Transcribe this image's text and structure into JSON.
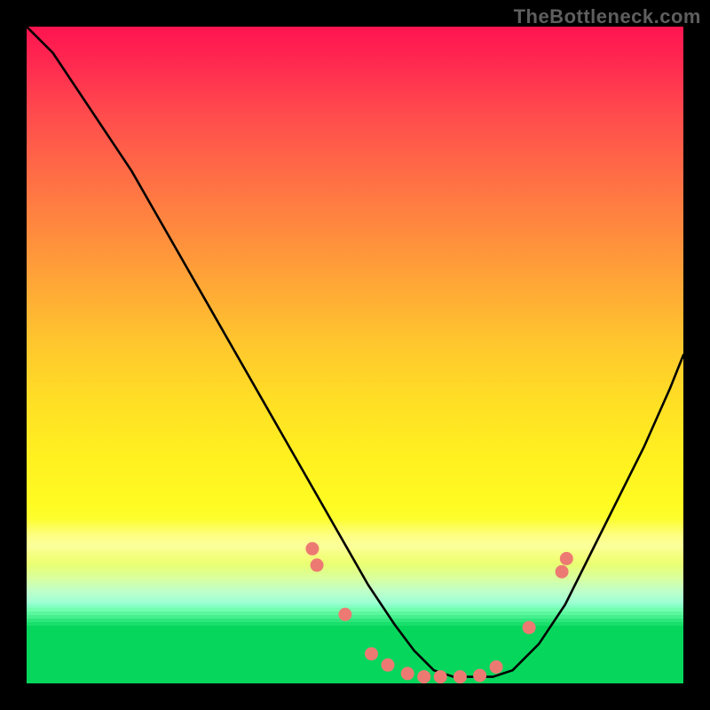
{
  "watermark": "TheBottleneck.com",
  "chart_data": {
    "type": "line",
    "title": "",
    "xlabel": "",
    "ylabel": "",
    "xlim": [
      0,
      100
    ],
    "ylim": [
      0,
      100
    ],
    "series": [
      {
        "name": "bottleneck-curve",
        "x": [
          0,
          4,
          8,
          12,
          16,
          20,
          24,
          28,
          32,
          36,
          40,
          44,
          48,
          52,
          56,
          59,
          62,
          65,
          68,
          71,
          74,
          78,
          82,
          86,
          90,
          94,
          98,
          100
        ],
        "y": [
          100,
          96,
          90,
          84,
          78,
          71,
          64,
          57,
          50,
          43,
          36,
          29,
          22,
          15,
          9,
          5,
          2,
          1,
          1,
          1,
          2,
          6,
          12,
          20,
          28,
          36,
          45,
          50
        ]
      }
    ],
    "markers": {
      "name": "threshold-dots",
      "color": "#ec7a73",
      "points": [
        {
          "x": 43.5,
          "y": 20.5
        },
        {
          "x": 44.2,
          "y": 18.0
        },
        {
          "x": 48.5,
          "y": 10.5
        },
        {
          "x": 52.5,
          "y": 4.5
        },
        {
          "x": 55.0,
          "y": 2.8
        },
        {
          "x": 58.0,
          "y": 1.5
        },
        {
          "x": 60.5,
          "y": 1.0
        },
        {
          "x": 63.0,
          "y": 1.0
        },
        {
          "x": 66.0,
          "y": 1.0
        },
        {
          "x": 69.0,
          "y": 1.2
        },
        {
          "x": 71.5,
          "y": 2.5
        },
        {
          "x": 76.5,
          "y": 8.5
        },
        {
          "x": 81.5,
          "y": 17.0
        },
        {
          "x": 82.2,
          "y": 19.0
        }
      ]
    }
  }
}
